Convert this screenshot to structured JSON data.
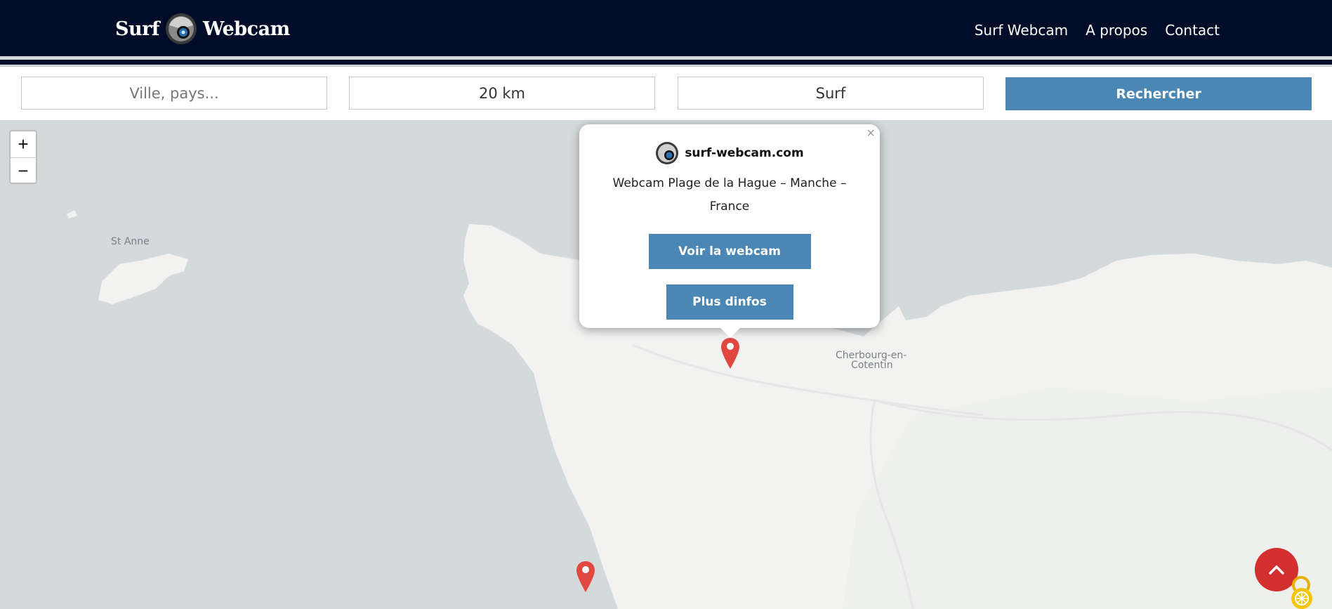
{
  "header": {
    "logo_left": "Surf",
    "logo_right": "Webcam",
    "nav": [
      "Surf Webcam",
      "A propos",
      "Contact"
    ]
  },
  "search": {
    "city_placeholder": "Ville, pays...",
    "radius": "20 km",
    "category": "Surf",
    "button": "Rechercher"
  },
  "map": {
    "zoom_in": "+",
    "zoom_out": "−",
    "labels": {
      "island": "St Anne",
      "city_line1": "Cherbourg-en-",
      "city_line2": "Cotentin"
    }
  },
  "popup": {
    "close": "×",
    "brand": "surf-webcam.com",
    "description": "Webcam Plage de la Hague – Manche – France",
    "view_button": "Voir la webcam",
    "info_button": "Plus dinfos"
  },
  "colors": {
    "header_bg": "#000c28",
    "accent": "#4a87b5",
    "marker": "#e0473e",
    "to_top": "#d32f2f",
    "sea": "#d4d9dc",
    "land": "#f2f2f1"
  },
  "icons": {
    "to_top": "chevron-up-icon",
    "marker": "map-pin-icon"
  }
}
